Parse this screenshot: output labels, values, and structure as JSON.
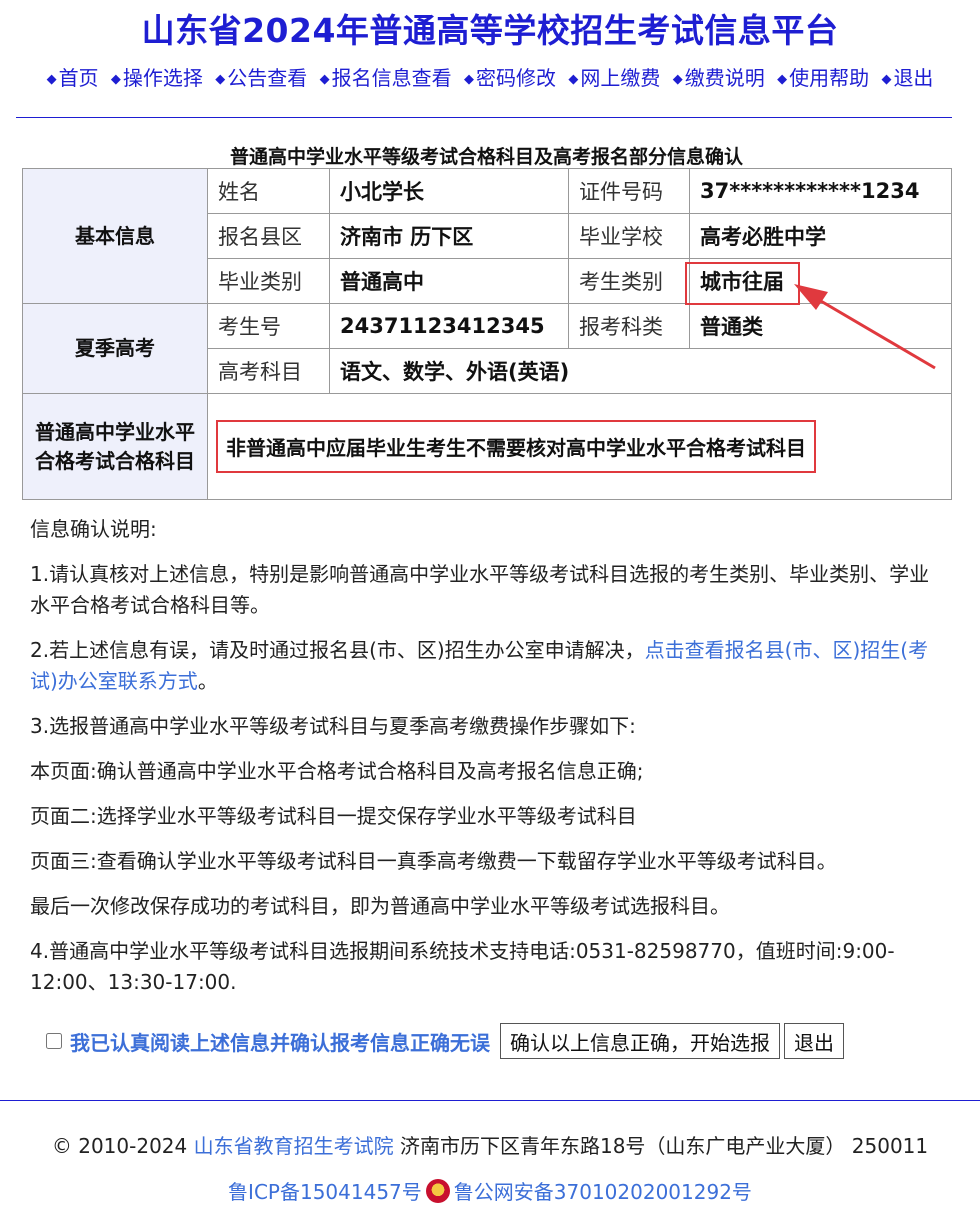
{
  "header": {
    "title": "山东省2024年普通高等学校招生考试信息平台",
    "nav": [
      "首页",
      "操作选择",
      "公告查看",
      "报名信息查看",
      "密码修改",
      "网上缴费",
      "缴费说明",
      "使用帮助",
      "退出"
    ]
  },
  "section_title": "普通高中学业水平等级考试合格科目及高考报名部分信息确认",
  "basic": {
    "group": "基本信息",
    "name_label": "姓名",
    "name_value": "小北学长",
    "id_label": "证件号码",
    "id_value": "37************1234",
    "county_label": "报名县区",
    "county_value": "济南市 历下区",
    "school_label": "毕业学校",
    "school_value": "高考必胜中学",
    "gradtype_label": "毕业类别",
    "gradtype_value": "普通高中",
    "examtype_label": "考生类别",
    "examtype_value": "城市往届"
  },
  "summer": {
    "group": "夏季高考",
    "examno_label": "考生号",
    "examno_value": "24371123412345",
    "category_label": "报考科类",
    "category_value": "普通类",
    "subjects_label": "高考科目",
    "subjects_value": "语文、数学、外语(英语)"
  },
  "qualified": {
    "group": "普通高中学业水平合格考试合格科目",
    "notice": "非普通高中应届毕业生考生不需要核对高中学业水平合格考试科目"
  },
  "explain": {
    "heading": "信息确认说明:",
    "p1": "1.请认真核对上述信息，特别是影响普通高中学业水平等级考试科目选报的考生类别、毕业类别、学业水平合格考试合格科目等。",
    "p2_text": "2.若上述信息有误，请及时通过报名县(市、区)招生办公室申请解决，",
    "p2_link": "点击查看报名县(市、区)招生(考试)办公室联系方式",
    "p2_end": "。",
    "p3": "3.选报普通高中学业水平等级考试科目与夏季高考缴费操作步骤如下:",
    "step1": "本页面:确认普通高中学业水平合格考试合格科目及高考报名信息正确;",
    "step2": "页面二:选择学业水平等级考试科目一提交保存学业水平等级考试科目",
    "step3": "页面三:查看确认学业水平等级考试科目一真季高考缴费一下载留存学业水平等级考试科目。",
    "step4": "最后一次修改保存成功的考试科目，即为普通高中学业水平等级考试选报科目。",
    "p4": "4.普通高中学业水平等级考试科目选报期间系统技术支持电话:0531-82598770，值班时间:9:00-12:00、13:30-17:00."
  },
  "confirm": {
    "checkbox_label": "我已认真阅读上述信息并确认报考信息正确无误",
    "start_button": "确认以上信息正确，开始选报",
    "exit_button": "退出"
  },
  "footer": {
    "copyright": "© 2010-2024",
    "org_link": "山东省教育招生考试院",
    "address": "济南市历下区青年东路18号（山东广电产业大厦） 250011",
    "icp": "鲁ICP备15041457号",
    "police": "鲁公网安备37010202001292号"
  }
}
